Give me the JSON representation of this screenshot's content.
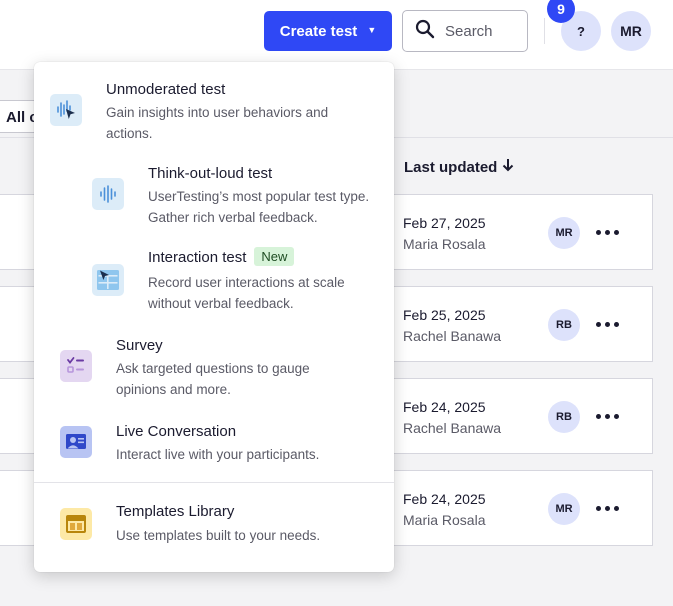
{
  "header": {
    "create_label": "Create test",
    "search_placeholder": "Search",
    "help_label": "?",
    "notification_count": "9",
    "user_initials": "MR"
  },
  "filter": {
    "label": "All c"
  },
  "list": {
    "sort_column": "Last updated",
    "rows": [
      {
        "date": "Feb 27, 2025",
        "user": "Maria Rosala",
        "initials": "MR"
      },
      {
        "date": "Feb 25, 2025",
        "user": "Rachel Banawa",
        "initials": "RB"
      },
      {
        "date": "Feb 24, 2025",
        "user": "Rachel Banawa",
        "initials": "RB"
      },
      {
        "date": "Feb 24, 2025",
        "user": "Maria Rosala",
        "initials": "MR"
      }
    ]
  },
  "menu": {
    "unmoderated": {
      "title": "Unmoderated test",
      "desc": "Gain insights into user behaviors and actions."
    },
    "think_out_loud": {
      "title": "Think-out-loud test",
      "desc": "UserTesting’s most popular test type. Gather rich verbal feedback."
    },
    "interaction": {
      "title": "Interaction test",
      "badge": "New",
      "desc": "Record user interactions at scale without verbal feedback."
    },
    "survey": {
      "title": "Survey",
      "desc": "Ask targeted questions to gauge opinions and more."
    },
    "live": {
      "title": "Live Conversation",
      "desc": "Interact live with your participants."
    },
    "templates": {
      "title": "Templates Library",
      "desc": "Use templates built to your needs."
    }
  },
  "icons": {
    "create_caret": "caret-down-icon",
    "search": "search-icon",
    "sort": "arrow-down-icon",
    "more": "more-horizontal-icon",
    "unmoderated": "waveform-cursor-icon",
    "think_out_loud": "waveform-icon",
    "interaction": "layout-cursor-icon",
    "survey": "checklist-icon",
    "live": "video-person-icon",
    "templates": "template-icon"
  },
  "colors": {
    "accent": "#2f48f5",
    "avatar_bg": "#dde2fb",
    "new_badge_bg": "#d7f3d9",
    "icon_light_blue": "#dcecf8",
    "icon_purple": "#e4d7f1",
    "icon_blue": "#b8c4f3",
    "icon_yellow": "#fde9a6"
  }
}
